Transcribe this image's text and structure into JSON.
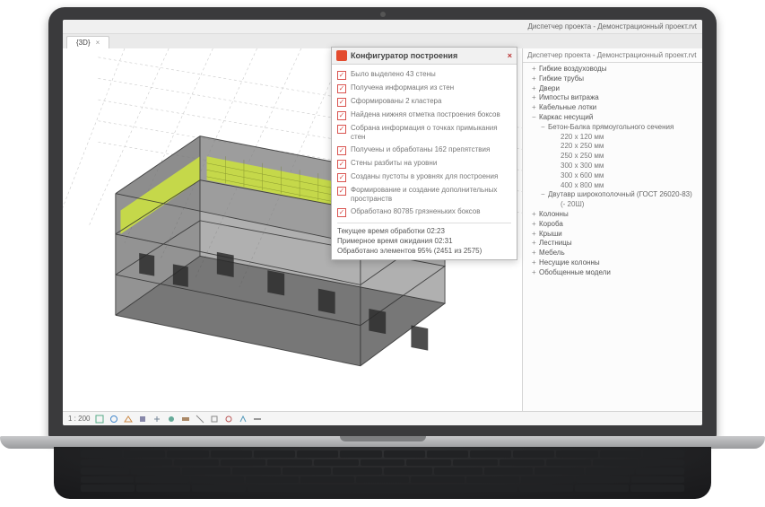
{
  "titlebar": {
    "text": "Диспетчер проекта - Демонстрационный проект.rvt"
  },
  "tab": {
    "label": "{3D}"
  },
  "configurator": {
    "title": "Конфигуратор построения",
    "steps": [
      "Было выделено 43 стены",
      "Получена информация из стен",
      "Сформированы 2 кластера",
      "Найдена нижняя отметка построения боксов",
      "Собрана информация о точках примыкания стен",
      "Получены и обработаны 162 препятствия",
      "Стены разбиты на уровни",
      "Созданы пустоты в уровнях для построения",
      "Формирование и создание дополнительных пространств",
      "Обработано 80785 грязненьких боксов"
    ],
    "status1": "Текущее время обработки 02:23",
    "status2": "Примерное время ожидания 02:31",
    "status3": "Обработано элементов  95% (2451 из 2575)"
  },
  "tree": {
    "title": "Диспетчер проекта - Демонстрационный проект.rvt",
    "items": [
      {
        "lvl": 1,
        "exp": "+",
        "label": "Гибкие воздуховоды"
      },
      {
        "lvl": 1,
        "exp": "+",
        "label": "Гибкие трубы"
      },
      {
        "lvl": 1,
        "exp": "+",
        "label": "Двери"
      },
      {
        "lvl": 1,
        "exp": "+",
        "label": "Импосты витража"
      },
      {
        "lvl": 1,
        "exp": "+",
        "label": "Кабельные лотки"
      },
      {
        "lvl": 1,
        "exp": "−",
        "label": "Каркас несущий"
      },
      {
        "lvl": 2,
        "exp": "−",
        "label": "Бетон-Балка прямоугольного сечения"
      },
      {
        "lvl": 3,
        "exp": "",
        "label": "220 x 120 мм"
      },
      {
        "lvl": 3,
        "exp": "",
        "label": "220 x 250 мм"
      },
      {
        "lvl": 3,
        "exp": "",
        "label": "250 x 250 мм"
      },
      {
        "lvl": 3,
        "exp": "",
        "label": "300 x 300 мм"
      },
      {
        "lvl": 3,
        "exp": "",
        "label": "300 x 600 мм"
      },
      {
        "lvl": 3,
        "exp": "",
        "label": "400 x 800 мм"
      },
      {
        "lvl": 2,
        "exp": "−",
        "label": "Двутавр широкополочный (ГОСТ 26020-83)"
      },
      {
        "lvl": 3,
        "exp": "",
        "label": "(- 20Ш)"
      },
      {
        "lvl": 1,
        "exp": "+",
        "label": "Колонны"
      },
      {
        "lvl": 1,
        "exp": "+",
        "label": "Короба"
      },
      {
        "lvl": 1,
        "exp": "+",
        "label": "Крыши"
      },
      {
        "lvl": 1,
        "exp": "+",
        "label": "Лестницы"
      },
      {
        "lvl": 1,
        "exp": "+",
        "label": "Мебель"
      },
      {
        "lvl": 1,
        "exp": "+",
        "label": "Несущие колонны"
      },
      {
        "lvl": 1,
        "exp": "+",
        "label": "Обобщенные модели"
      }
    ]
  },
  "statusbar": {
    "scale": "1 : 200"
  }
}
